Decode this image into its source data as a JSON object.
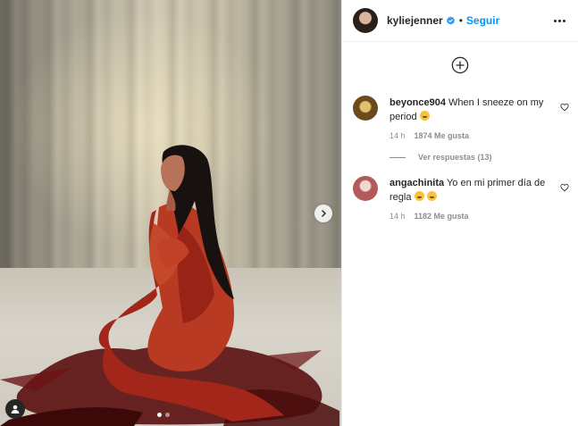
{
  "header": {
    "username": "kyliejenner",
    "separator": "•",
    "follow_label": "Seguir"
  },
  "carousel": {
    "slide_count": 2,
    "active_slide": 1
  },
  "comments": [
    {
      "username": "beyonce904",
      "text": "When I sneeze on my period",
      "emojis": [
        "grinning-face"
      ],
      "time": "14 h",
      "likes": "1874 Me gusta",
      "replies_label": "Ver respuestas (13)"
    },
    {
      "username": "angachinita",
      "text": "Yo en mi primer día de regla",
      "emojis": [
        "grinning-squinting-face",
        "rolling-laughing-face"
      ],
      "time": "14 h",
      "likes": "1182 Me gusta"
    }
  ],
  "icons": {
    "verified": "verified-badge-icon",
    "more": "more-options-icon",
    "load_more": "plus-circle-icon",
    "like": "heart-icon",
    "next": "chevron-right-icon",
    "tag": "user-tag-icon"
  },
  "colors": {
    "accent_blue": "#0095f6",
    "text_primary": "#262626",
    "text_secondary": "#8e8e8e",
    "border": "#efefef"
  }
}
